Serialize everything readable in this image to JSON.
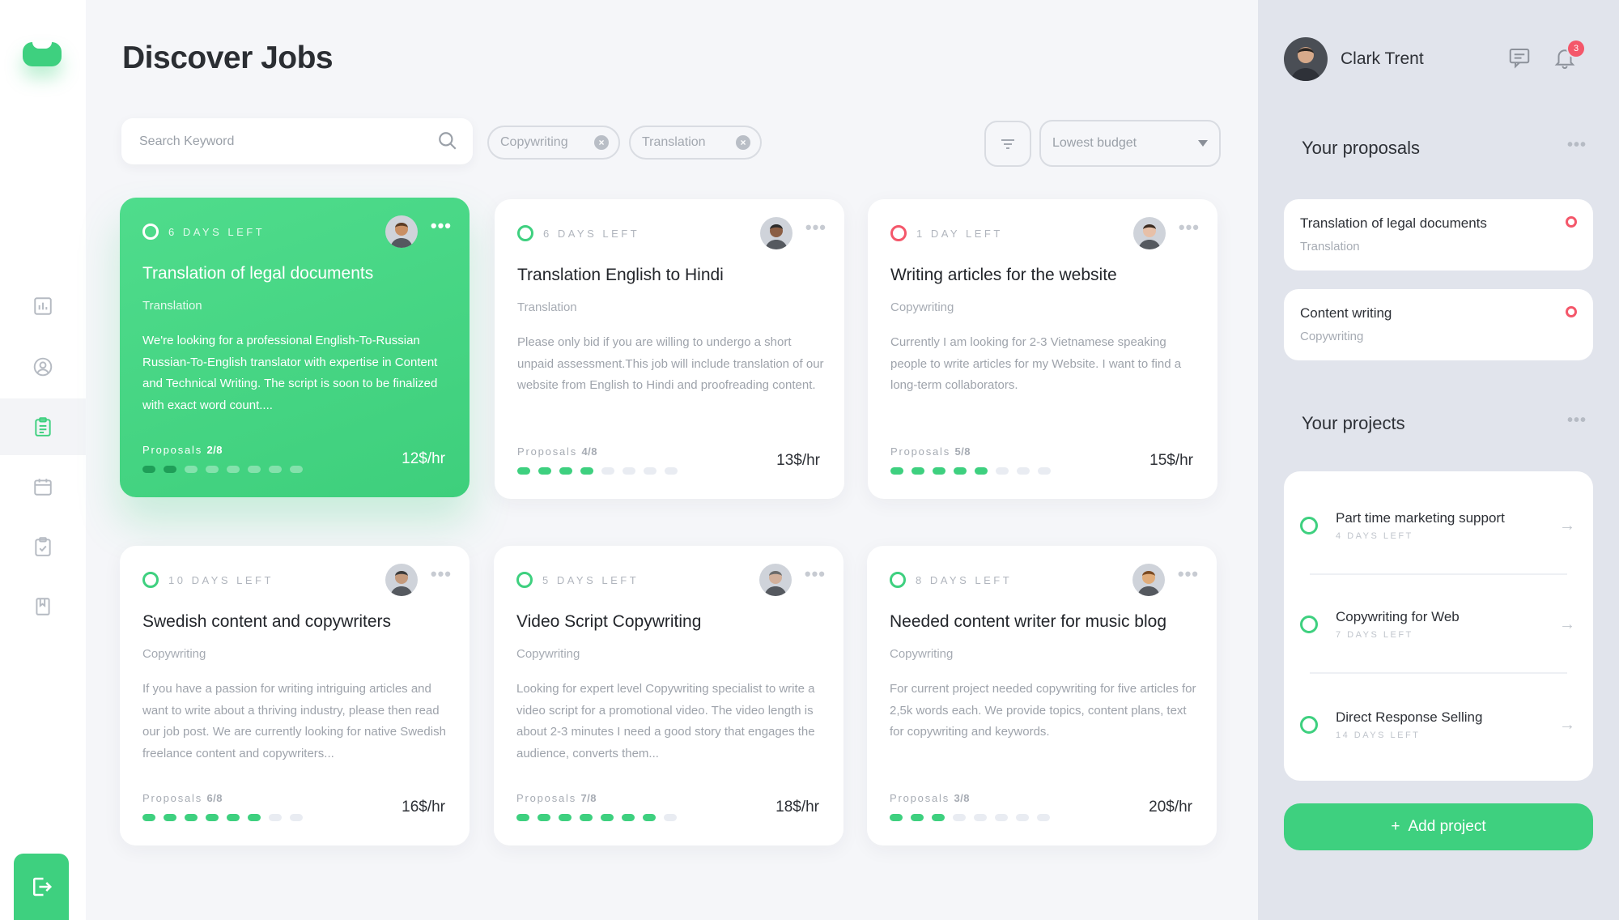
{
  "app": {
    "page_title": "Discover Jobs"
  },
  "search": {
    "placeholder": "Search Keyword",
    "value": ""
  },
  "filters": {
    "chips": [
      "Copywriting",
      "Translation"
    ],
    "sort_selected": "Lowest budget"
  },
  "jobs": [
    {
      "days_left": "6 DAYS LEFT",
      "status": "green",
      "title": "Translation of legal documents",
      "category": "Translation",
      "description": "We're looking for a professional English-To-Russian Russian-To-English translator with expertise in Content and Technical Writing. The script is soon to be finalized with exact word count....",
      "proposals_label": "Proposals",
      "proposals_count": "2/8",
      "proposals_filled": 2,
      "proposals_total": 8,
      "rate": "12$/hr",
      "featured": true
    },
    {
      "days_left": "6 DAYS LEFT",
      "status": "green",
      "title": "Translation English to Hindi",
      "category": "Translation",
      "description": "Please only bid if you are willing to undergo a short unpaid assessment.This job will include translation of our website from English to Hindi and proofreading content.",
      "proposals_label": "Proposals",
      "proposals_count": "4/8",
      "proposals_filled": 4,
      "proposals_total": 8,
      "rate": "13$/hr",
      "featured": false
    },
    {
      "days_left": "1 DAY LEFT",
      "status": "red",
      "title": "Writing articles for the website",
      "category": "Copywriting",
      "description": "Currently I am looking for 2-3 Vietnamese speaking people to write articles for my Website. I want to find a long-term collaborators.",
      "proposals_label": "Proposals",
      "proposals_count": "5/8",
      "proposals_filled": 5,
      "proposals_total": 8,
      "rate": "15$/hr",
      "featured": false
    },
    {
      "days_left": "10 DAYS LEFT",
      "status": "green",
      "title": "Swedish content and copywriters",
      "category": "Copywriting",
      "description": "If you have a passion for writing intriguing articles and want to write about a thriving industry, please then read our job post. We are currently looking for native Swedish freelance content and copywriters...",
      "proposals_label": "Proposals",
      "proposals_count": "6/8",
      "proposals_filled": 6,
      "proposals_total": 8,
      "rate": "16$/hr",
      "featured": false
    },
    {
      "days_left": "5 DAYS LEFT",
      "status": "green",
      "title": "Video Script Copywriting",
      "category": "Copywriting",
      "description": "Looking for expert level Copywriting specialist to write a video script for a promotional video. The video length is about 2-3 minutes I need a good story that engages the audience, converts them...",
      "proposals_label": "Proposals",
      "proposals_count": "7/8",
      "proposals_filled": 7,
      "proposals_total": 8,
      "rate": "18$/hr",
      "featured": false
    },
    {
      "days_left": "8 DAYS LEFT",
      "status": "green",
      "title": "Needed content writer for music blog",
      "category": "Copywriting",
      "description": "For current project needed copywriting for five articles for 2,5k words each. We provide topics, content plans, text for copywriting and keywords.",
      "proposals_label": "Proposals",
      "proposals_count": "3/8",
      "proposals_filled": 3,
      "proposals_total": 8,
      "rate": "20$/hr",
      "featured": false
    }
  ],
  "user": {
    "name": "Clark Trent",
    "notifications": "3"
  },
  "proposals_section": {
    "title": "Your proposals",
    "items": [
      {
        "title": "Translation of legal documents",
        "category": "Translation"
      },
      {
        "title": "Content writing",
        "category": "Copywriting"
      }
    ]
  },
  "projects_section": {
    "title": "Your projects",
    "items": [
      {
        "name": "Part time marketing support",
        "days": "4 DAYS LEFT"
      },
      {
        "name": "Copywriting for Web",
        "days": "7 DAYS LEFT"
      },
      {
        "name": "Direct Response Selling",
        "days": "14 DAYS LEFT"
      }
    ],
    "add_label": "Add project"
  },
  "colors": {
    "accent": "#3ed07f",
    "alert": "#f4576a",
    "panel": "#e1e4ec"
  },
  "icons": {
    "rail": [
      "chart-icon",
      "user-icon",
      "clipboard-icon",
      "calendar-icon",
      "checklist-icon",
      "bookmark-icon"
    ],
    "logout": "logout-icon"
  }
}
